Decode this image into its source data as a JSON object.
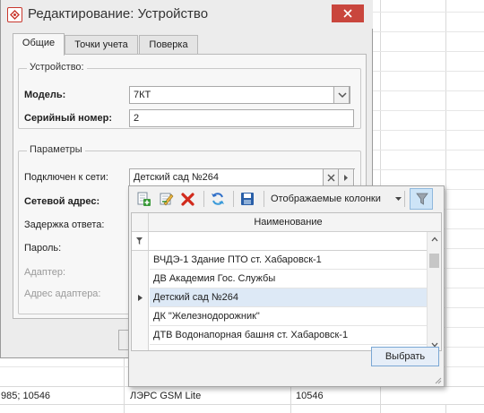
{
  "dialog": {
    "title": "Редактирование:  Устройство",
    "tabs": [
      {
        "label": "Общие",
        "active": true
      },
      {
        "label": "Точки учета",
        "active": false
      },
      {
        "label": "Поверка",
        "active": false
      }
    ],
    "device_group": {
      "legend": "Устройство:",
      "model_label": "Модель:",
      "model_value": "7КТ",
      "serial_label": "Серийный номер:",
      "serial_value": "2"
    },
    "params_group": {
      "legend": "Параметры",
      "network_label": "Подключен к сети:",
      "network_value": "Детский сад №264",
      "net_address_label": "Сетевой адрес:",
      "response_delay_label": "Задержка ответа:",
      "password_label": "Пароль:",
      "adapter_label": "Адаптер:",
      "adapter_address_label": "Адрес адаптера:"
    }
  },
  "popup": {
    "toolbar": {
      "columns_label": "Отображаемые колонки"
    },
    "grid": {
      "column_header": "Наименование",
      "rows": [
        {
          "name": "ВЧДЭ-1 Здание ПТО ст. Хабаровск-1",
          "selected": false
        },
        {
          "name": "ДВ Академия Гос. Службы",
          "selected": false
        },
        {
          "name": "Детский сад №264",
          "selected": true
        },
        {
          "name": "ДК \"Железнодорожник\"",
          "selected": false
        },
        {
          "name": "ДТВ Водонапорная башня ст. Хабаровск-1",
          "selected": false
        }
      ]
    },
    "choose_button": "Выбрать"
  },
  "background_table": {
    "row": [
      "985; 10546",
      "ЛЭРС GSM Lite",
      "10546"
    ]
  },
  "colors": {
    "close_button": "#c9463d",
    "selected_row": "#dde9f6",
    "filter_active": "#cde4f7"
  }
}
